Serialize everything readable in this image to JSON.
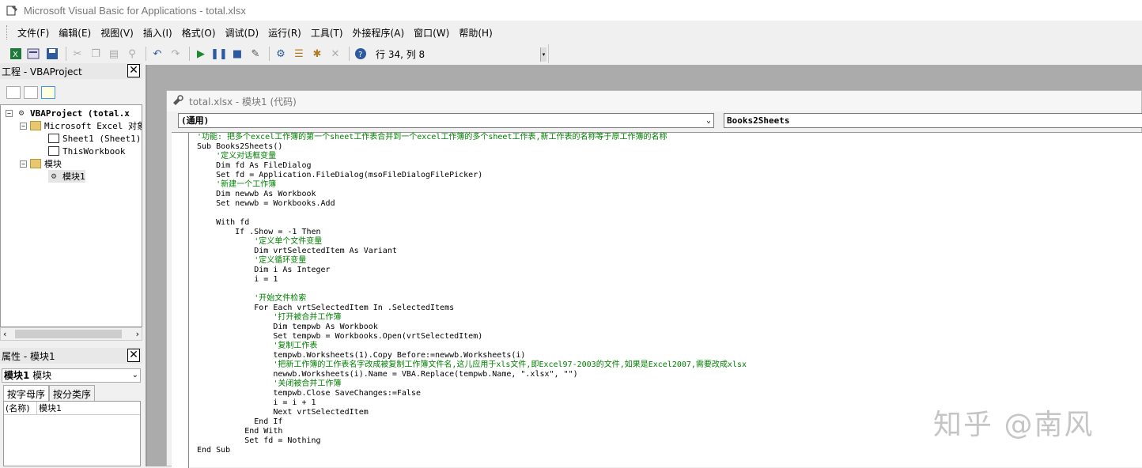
{
  "window": {
    "title": "Microsoft Visual Basic for Applications - total.xlsx"
  },
  "menu": [
    "文件(F)",
    "编辑(E)",
    "视图(V)",
    "插入(I)",
    "格式(O)",
    "调试(D)",
    "运行(R)",
    "工具(T)",
    "外接程序(A)",
    "窗口(W)",
    "帮助(H)"
  ],
  "toolbar": {
    "status": "行 34, 列 8"
  },
  "project": {
    "title": "工程 - VBAProject",
    "tree": [
      {
        "label": "VBAProject (total.x",
        "bold": true
      },
      {
        "label": "Microsoft Excel 对象"
      },
      {
        "label": "Sheet1 (Sheet1)"
      },
      {
        "label": "ThisWorkbook"
      },
      {
        "label": "模块"
      },
      {
        "label": "模块1"
      }
    ]
  },
  "properties": {
    "title": "属性 - 模块1",
    "object_name": "模块1",
    "object_type": "模块",
    "tabs": [
      "按字母序",
      "按分类序"
    ],
    "rows": [
      {
        "key": "(名称)",
        "value": "模块1"
      }
    ]
  },
  "code_window": {
    "title": "total.xlsx - 模块1 (代码)",
    "object_combo": "(通用)",
    "proc_combo": "Books2Sheets",
    "lines": [
      {
        "text": "'功能: 把多个excel工作簿的第一个sheet工作表合并到一个excel工作簿的多个sheet工作表,新工作表的名称等于原工作簿的名称",
        "comment": true
      },
      {
        "text": "Sub Books2Sheets()",
        "comment": false
      },
      {
        "text": "    '定义对话框变量",
        "comment": true
      },
      {
        "text": "    Dim fd As FileDialog",
        "comment": false
      },
      {
        "text": "    Set fd = Application.FileDialog(msoFileDialogFilePicker)",
        "comment": false
      },
      {
        "text": "    '新建一个工作簿",
        "comment": true
      },
      {
        "text": "    Dim newwb As Workbook",
        "comment": false
      },
      {
        "text": "    Set newwb = Workbooks.Add",
        "comment": false
      },
      {
        "text": "",
        "comment": false
      },
      {
        "text": "    With fd",
        "comment": false
      },
      {
        "text": "        If .Show = -1 Then",
        "comment": false
      },
      {
        "text": "            '定义单个文件变量",
        "comment": true
      },
      {
        "text": "            Dim vrtSelectedItem As Variant",
        "comment": false
      },
      {
        "text": "            '定义循环变量",
        "comment": true
      },
      {
        "text": "            Dim i As Integer",
        "comment": false
      },
      {
        "text": "            i = 1",
        "comment": false
      },
      {
        "text": "",
        "comment": false
      },
      {
        "text": "            '开始文件检索",
        "comment": true
      },
      {
        "text": "            For Each vrtSelectedItem In .SelectedItems",
        "comment": false
      },
      {
        "text": "                '打开被合并工作簿",
        "comment": true
      },
      {
        "text": "                Dim tempwb As Workbook",
        "comment": false
      },
      {
        "text": "                Set tempwb = Workbooks.Open(vrtSelectedItem)",
        "comment": false
      },
      {
        "text": "                '复制工作表",
        "comment": true
      },
      {
        "text": "                tempwb.Worksheets(1).Copy Before:=newwb.Worksheets(i)",
        "comment": false
      },
      {
        "text": "                '把新工作簿的工作表名字改成被复制工作簿文件名,这儿应用于xls文件,即Excel97-2003的文件,如果是Excel2007,需要改成xlsx",
        "comment": true
      },
      {
        "text": "                newwb.Worksheets(i).Name = VBA.Replace(tempwb.Name, \".xlsx\", \"\")",
        "comment": false
      },
      {
        "text": "                '关闭被合并工作簿",
        "comment": true
      },
      {
        "text": "                tempwb.Close SaveChanges:=False",
        "comment": false
      },
      {
        "text": "                i = i + 1",
        "comment": false
      },
      {
        "text": "                Next vrtSelectedItem",
        "comment": false
      },
      {
        "text": "            End If",
        "comment": false
      },
      {
        "text": "          End With",
        "comment": false
      },
      {
        "text": "          Set fd = Nothing",
        "comment": false
      },
      {
        "text": "End Sub",
        "comment": false
      }
    ]
  },
  "watermark": "知乎 @南风",
  "colors": {
    "comment": "#008000",
    "mdi_bg": "#ababab"
  }
}
